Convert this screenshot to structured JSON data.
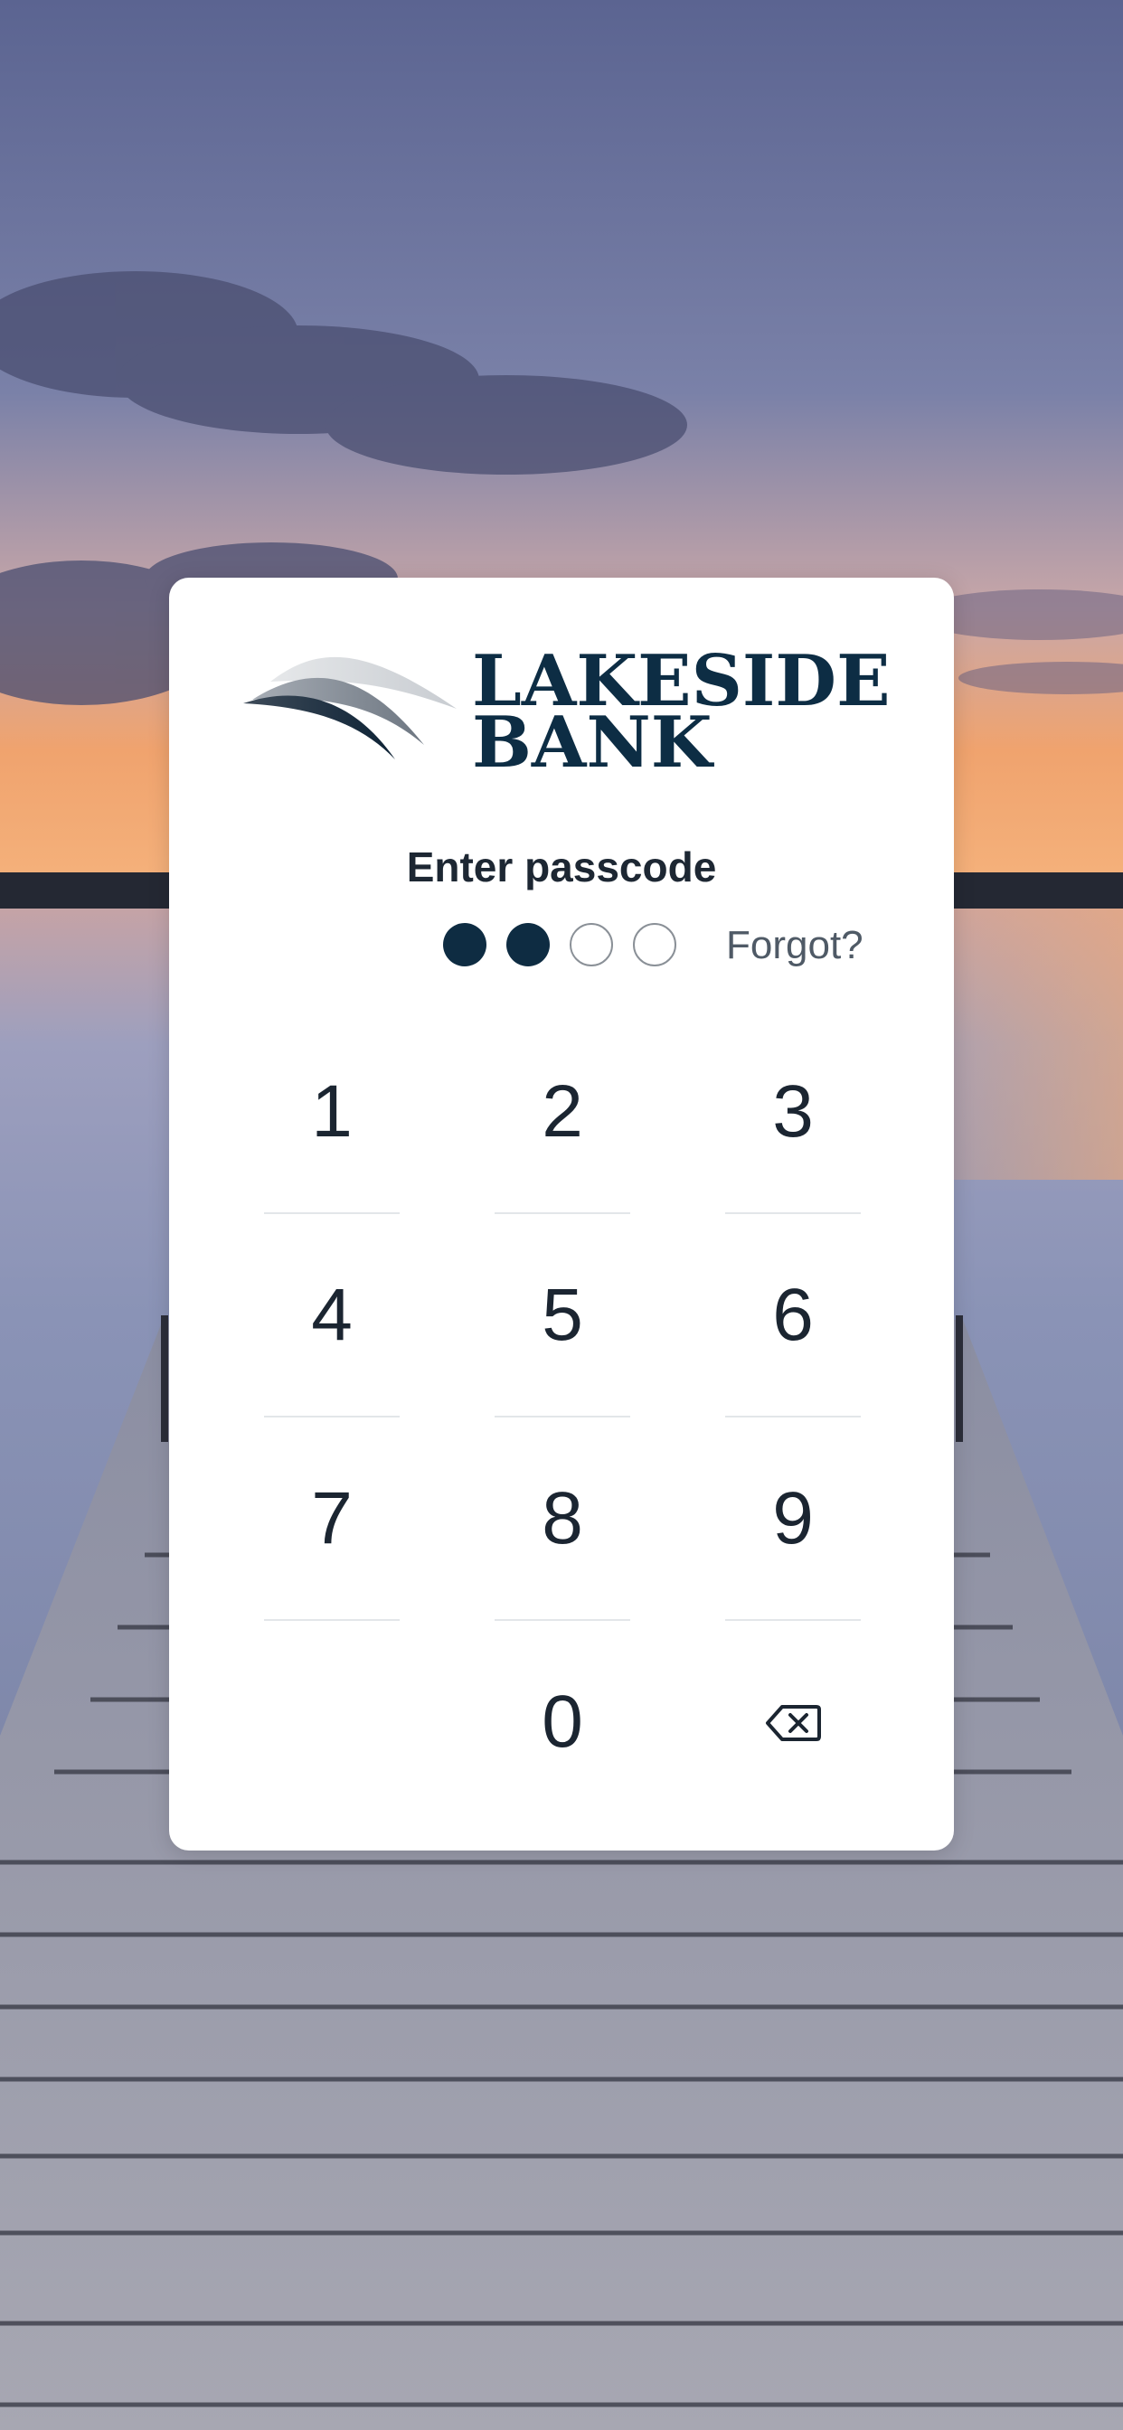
{
  "app": {
    "name": "Lakeside Bank passcode screen"
  },
  "brand": {
    "line1": "LAKESIDE",
    "line2": "BANK",
    "color": "#0d2d44"
  },
  "passcode": {
    "title": "Enter passcode",
    "length": 4,
    "entered": 2,
    "forgot_label": "Forgot?"
  },
  "keypad": {
    "keys": [
      "1",
      "2",
      "3",
      "4",
      "5",
      "6",
      "7",
      "8",
      "9",
      "",
      "0",
      "backspace"
    ],
    "backspace_icon": "backspace-icon"
  },
  "colors": {
    "accent": "#0e2c42",
    "text": "#1b2531"
  }
}
